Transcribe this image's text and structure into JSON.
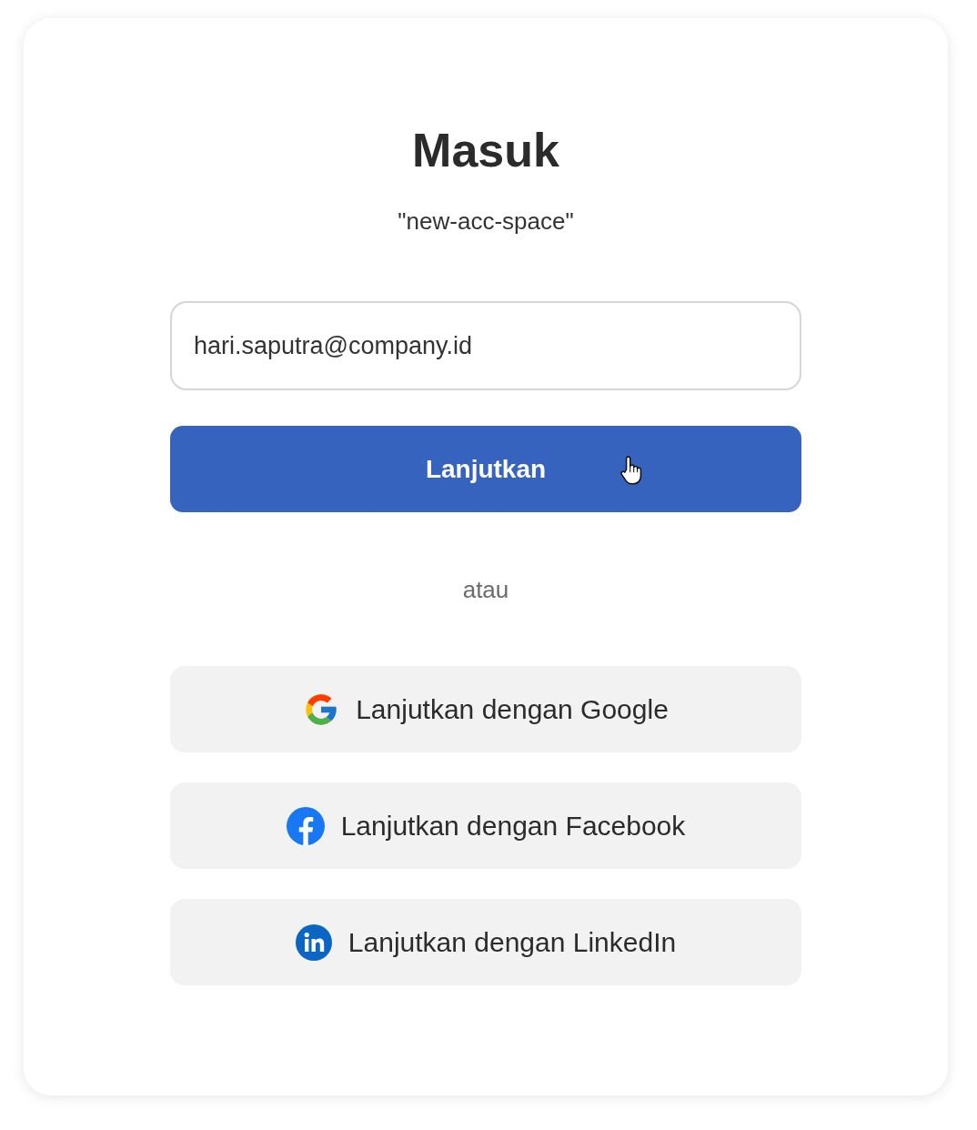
{
  "title": "Masuk",
  "subtitle": "\"new-acc-space\"",
  "email_field": {
    "value": "hari.saputra@company.id"
  },
  "continue_button": {
    "label": "Lanjutkan"
  },
  "divider_text": "atau",
  "social_buttons": [
    {
      "kind": "google",
      "label": "Lanjutkan dengan Google"
    },
    {
      "kind": "facebook",
      "label": "Lanjutkan dengan Facebook"
    },
    {
      "kind": "linkedin",
      "label": "Lanjutkan dengan LinkedIn"
    }
  ]
}
